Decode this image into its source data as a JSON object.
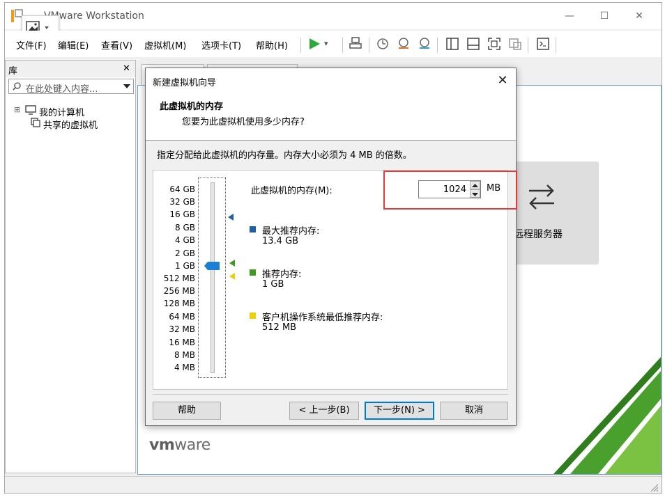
{
  "window": {
    "title": "VMware Workstation",
    "minimize": "—",
    "maximize": "☐",
    "close": "✕"
  },
  "menubar": {
    "items": [
      "文件(F)",
      "编辑(E)",
      "查看(V)",
      "虚拟机(M)",
      "选项卡(T)",
      "帮助(H)"
    ]
  },
  "toolbar": {
    "play_dropdown": "▾"
  },
  "library": {
    "title": "库",
    "close": "✕",
    "search_placeholder": "在此处键入内容...",
    "tree": [
      {
        "expander": "⊞",
        "label": "我的计算机"
      },
      {
        "expander": "",
        "label": "共享的虚拟机"
      }
    ]
  },
  "home": {
    "remote_server_label": "远程服务器",
    "brand": {
      "vm": "vm",
      "ware": "ware"
    }
  },
  "dialog": {
    "title": "新建虚拟机向导",
    "close": "✕",
    "heading": "此虚拟机的内存",
    "subheading": "您要为此虚拟机使用多少内存?",
    "instruction": "指定分配给此虚拟机的内存量。内存大小必须为 4 MB 的倍数。",
    "memory_label": "此虚拟机的内存(M):",
    "memory_value": "1024",
    "memory_unit": "MB",
    "scale": [
      "64 GB",
      "32 GB",
      "16 GB",
      "8 GB",
      "4 GB",
      "2 GB",
      "1 GB",
      "512 MB",
      "256 MB",
      "128 MB",
      "64 MB",
      "32 MB",
      "16 MB",
      "8 MB",
      "4 MB"
    ],
    "legend": [
      {
        "title": "最大推荐内存:",
        "value": "13.4 GB",
        "color": "#1e5fa8"
      },
      {
        "title": "推荐内存:",
        "value": "1 GB",
        "color": "#3f9a20"
      },
      {
        "title": "客户机操作系统最低推荐内存:",
        "value": "512 MB",
        "color": "#f2cf00"
      }
    ],
    "buttons": {
      "help": "帮助",
      "back": "< 上一步(B)",
      "next": "下一步(N) >",
      "cancel": "取消"
    },
    "highlight_color": "#e23a3a",
    "accent_color": "#0078d7"
  }
}
